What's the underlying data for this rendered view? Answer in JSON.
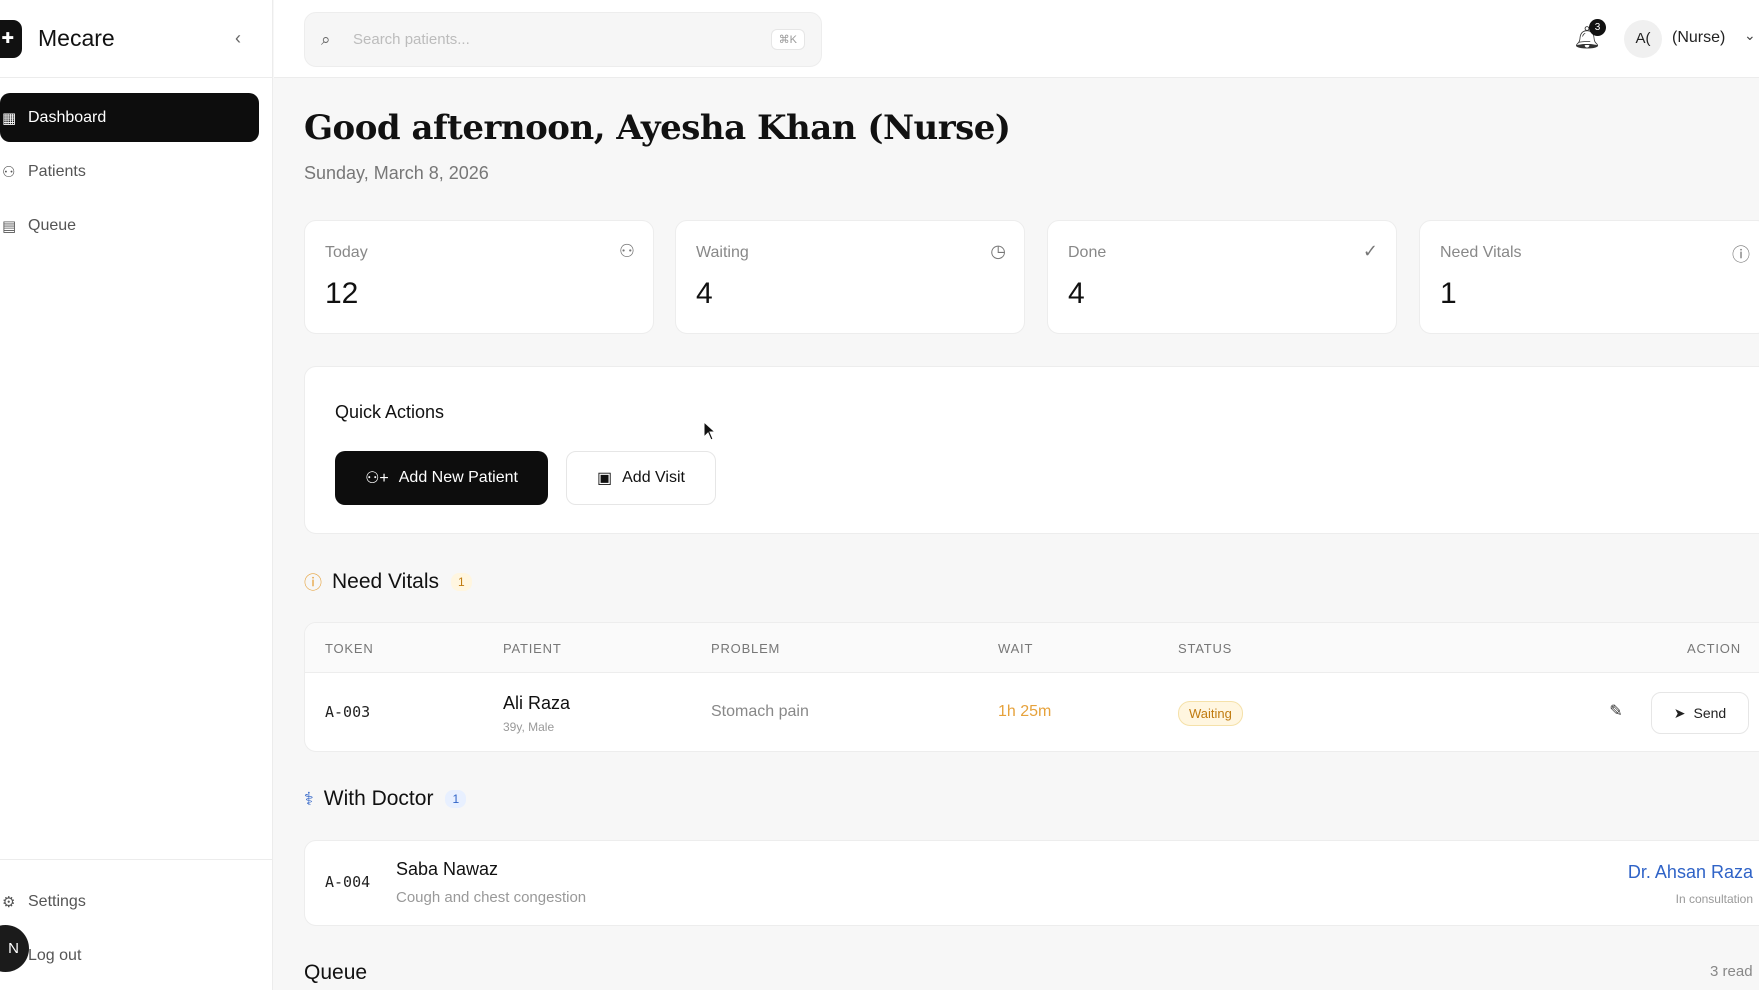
{
  "app": {
    "name": "Mecare"
  },
  "sidebar": {
    "items": [
      {
        "label": "Dashboard",
        "icon": "dashboard-icon",
        "active": true
      },
      {
        "label": "Patients",
        "icon": "users-icon",
        "active": false
      },
      {
        "label": "Queue",
        "icon": "clipboard-icon",
        "active": false
      }
    ],
    "footer": [
      {
        "label": "Settings",
        "icon": "gear-icon"
      },
      {
        "label": "Log out",
        "icon": "logout-icon"
      }
    ],
    "avatar_initial": "N"
  },
  "topbar": {
    "search_placeholder": "Search patients...",
    "search_shortcut": "⌘K",
    "notification_count": "3",
    "user_initials": "A(",
    "user_role": "(Nurse)"
  },
  "greeting": {
    "title": "Good afternoon, Ayesha Khan (Nurse)",
    "date": "Sunday, March 8, 2026"
  },
  "stats": [
    {
      "label": "Today",
      "value": "12",
      "icon": "users-icon"
    },
    {
      "label": "Waiting",
      "value": "4",
      "icon": "clock-icon"
    },
    {
      "label": "Done",
      "value": "4",
      "icon": "check-circle-icon"
    },
    {
      "label": "Need Vitals",
      "value": "1",
      "icon": "info-icon"
    }
  ],
  "quick_actions": {
    "title": "Quick Actions",
    "add_patient": "Add New Patient",
    "add_visit": "Add Visit"
  },
  "need_vitals": {
    "title": "Need Vitals",
    "count": "1",
    "columns": [
      "TOKEN",
      "PATIENT",
      "PROBLEM",
      "WAIT",
      "STATUS",
      "ACTION"
    ],
    "rows": [
      {
        "token": "A-003",
        "patient": "Ali Raza",
        "patient_meta": "39y, Male",
        "problem": "Stomach pain",
        "wait": "1h 25m",
        "status": "Waiting",
        "send": "Send"
      }
    ]
  },
  "with_doctor": {
    "title": "With Doctor",
    "count": "1",
    "rows": [
      {
        "token": "A-004",
        "patient": "Saba Nawaz",
        "problem": "Cough and chest congestion",
        "doctor": "Dr. Ahsan Raza",
        "doctor_status": "In consultation"
      }
    ]
  },
  "queue": {
    "title": "Queue",
    "ready": "3 read"
  },
  "colors": {
    "accent": "#0d0d0d",
    "warning": "#e6a23c",
    "doctor_link": "#2f63c7"
  }
}
